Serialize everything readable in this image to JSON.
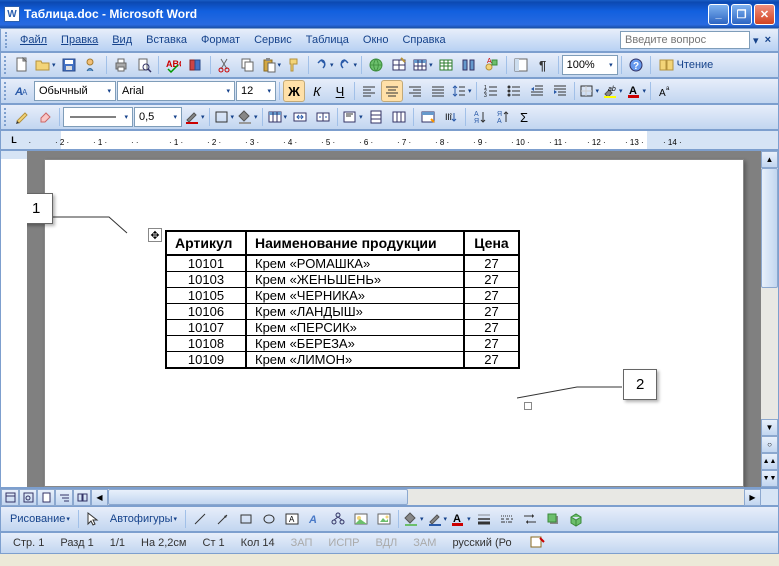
{
  "window": {
    "title": "Таблица.doc - Microsoft Word",
    "help_placeholder": "Введите вопрос"
  },
  "menu": [
    "Файл",
    "Правка",
    "Вид",
    "Вставка",
    "Формат",
    "Сервис",
    "Таблица",
    "Окно",
    "Справка"
  ],
  "formatting": {
    "style": "Обычный",
    "font": "Arial",
    "size": "12"
  },
  "tables_toolbar": {
    "line_weight": "0,5"
  },
  "standard": {
    "zoom": "100%",
    "reading_label": "Чтение"
  },
  "callouts": {
    "one": "1",
    "two": "2"
  },
  "table": {
    "headers": [
      "Артикул",
      "Наименование продукции",
      "Цена"
    ],
    "rows": [
      [
        "10101",
        "Крем   «РОМАШКА»",
        "27"
      ],
      [
        "10103",
        "Крем   «ЖЕНЬШЕНЬ»",
        "27"
      ],
      [
        "10105",
        "Крем   «ЧЕРНИКА»",
        "27"
      ],
      [
        "10106",
        "Крем   «ЛАНДЫШ»",
        "27"
      ],
      [
        "10107",
        "Крем   «ПЕРСИК»",
        "27"
      ],
      [
        "10108",
        "Крем   «БЕРЕЗА»",
        "27"
      ],
      [
        "10109",
        "Крем   «ЛИМОН»",
        "27"
      ]
    ]
  },
  "drawing": {
    "label": "Рисование",
    "autoshapes": "Автофигуры"
  },
  "status": {
    "page": "Стр. 1",
    "section": "Разд 1",
    "pages": "1/1",
    "at": "На  2,2см",
    "line": "Ст 1",
    "col": "Кол 14",
    "rec": "ЗАП",
    "trk": "ИСПР",
    "ext": "ВДЛ",
    "ovr": "ЗАМ",
    "lang": "русский (Ро"
  }
}
